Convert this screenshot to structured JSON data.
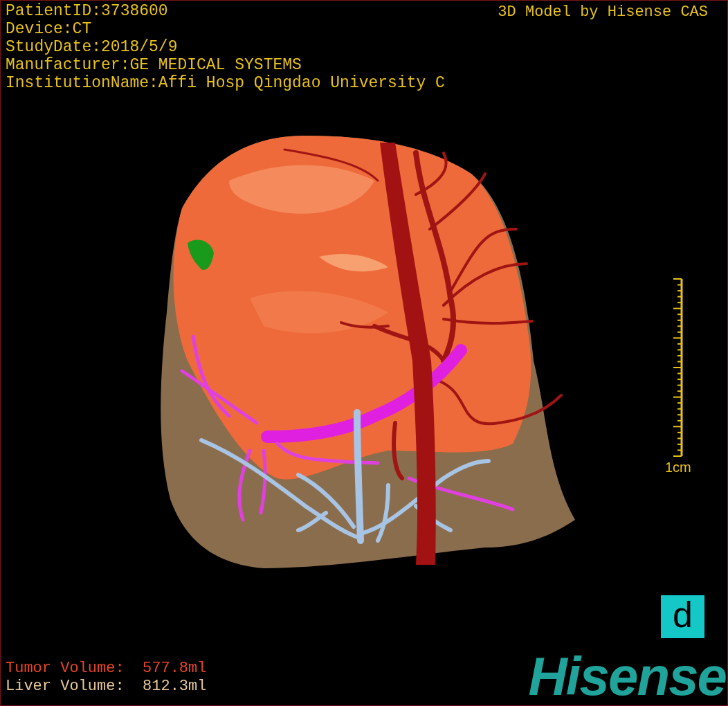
{
  "info_lines": [
    "PatientID:3738600",
    "Device:CT",
    "StudyDate:2018/5/9",
    "Manufacturer:GE MEDICAL SYSTEMS",
    "InstitutionName:Affi Hosp Qingdao University C"
  ],
  "title": "3D Model by Hisense CAS",
  "scale_bar": {
    "label": "1cm"
  },
  "volumes": [
    {
      "kind": "tumor",
      "text": "Tumor Volume:  577.8ml"
    },
    {
      "kind": "liver",
      "text": "Liver Volume:  812.3ml"
    }
  ],
  "view_button": {
    "label": "d"
  },
  "logo": "Hisense"
}
